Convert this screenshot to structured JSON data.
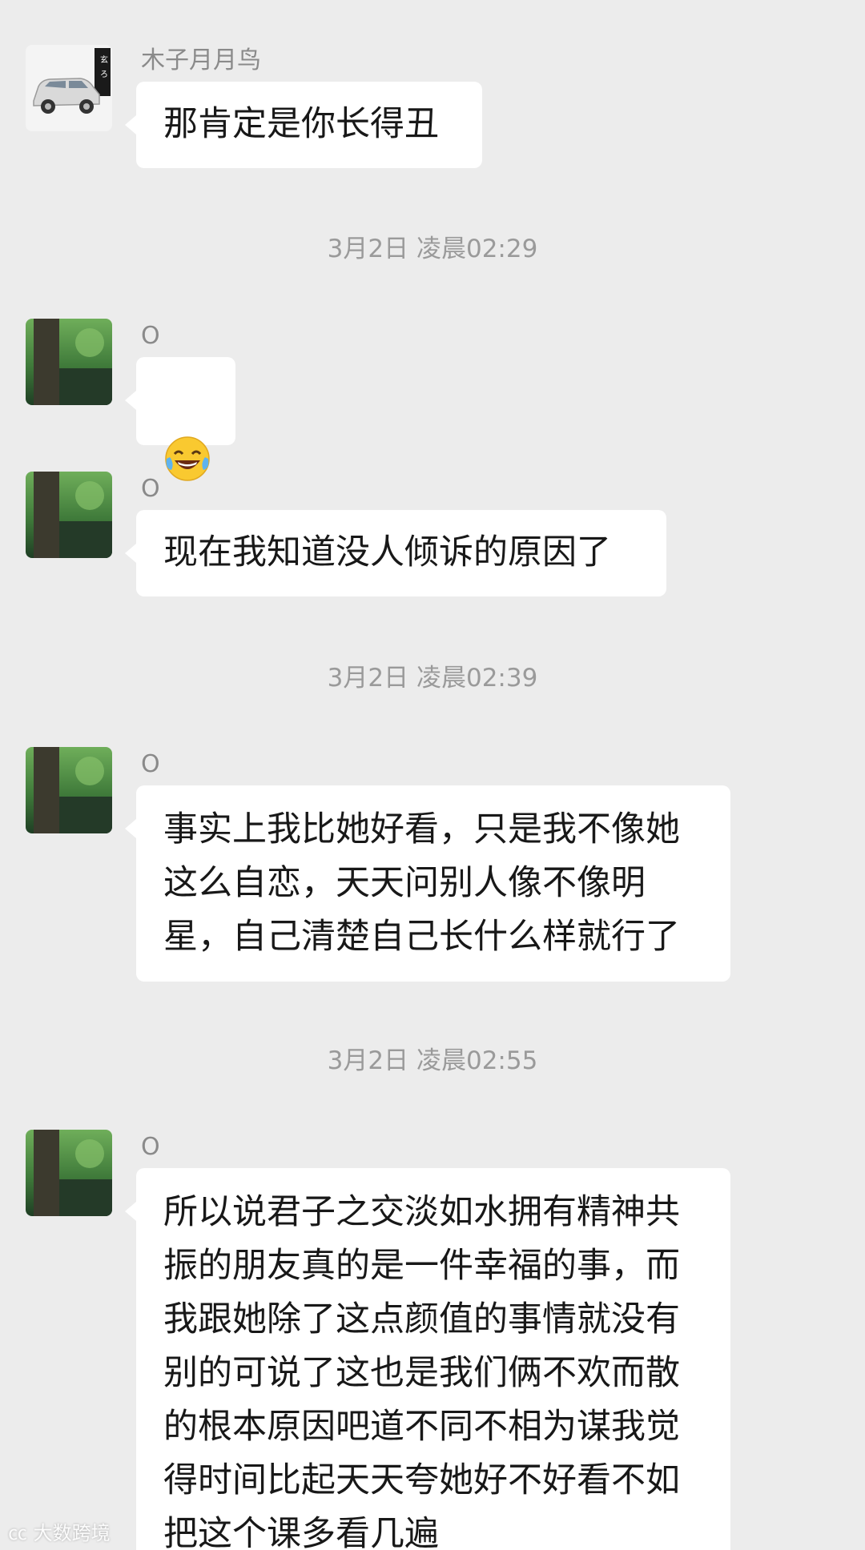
{
  "messages": [
    {
      "sender": "木子月月鸟",
      "text": "那肯定是你长得丑"
    },
    {
      "sender": "O",
      "emoji": "😂",
      "emoji_name": "tears-of-joy-emoji"
    },
    {
      "sender": "O",
      "text": "现在我知道没人倾诉的原因了"
    },
    {
      "sender": "O",
      "text": "事实上我比她好看，只是我不像她\n这么自恋，天天问别人像不像明\n星，自己清楚自己长什么样就行了"
    },
    {
      "sender": "O",
      "text": "所以说君子之交淡如水拥有精神共\n振的朋友真的是一件幸福的事，而\n我跟她除了这点颜值的事情就没有\n别的可说了这也是我们俩不欢而散\n的根本原因吧道不同不相为谋我觉\n得时间比起天天夸她好不好看不如\n把这个课多看几遍"
    }
  ],
  "timestamps": [
    "3月2日 凌晨02:29",
    "3月2日 凌晨02:39",
    "3月2日 凌晨02:55"
  ],
  "watermark": "大数跨境",
  "icons": {
    "car_avatar": "car-avatar-icon",
    "forest_avatar": "forest-avatar-icon"
  },
  "colors": {
    "background": "#ececec",
    "bubble": "#ffffff",
    "text": "#181818",
    "meta": "#9a9a9a"
  }
}
